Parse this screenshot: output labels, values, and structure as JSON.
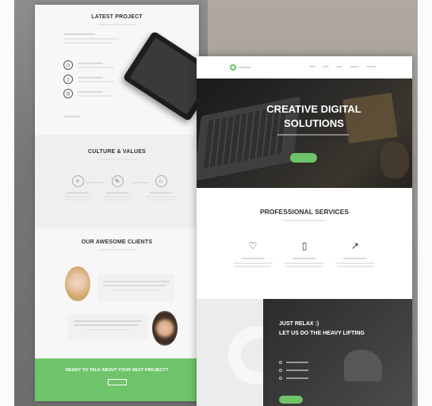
{
  "left_page": {
    "latest_project": {
      "title": "LATEST PROJECT",
      "items": [
        {
          "icon": "clock-icon",
          "glyph": "◷"
        },
        {
          "icon": "phone-icon",
          "glyph": "▯"
        },
        {
          "icon": "lock-icon",
          "glyph": "⊡"
        }
      ]
    },
    "culture": {
      "title": "CULTURE & VALUES",
      "items": [
        {
          "icon": "lightbulb-icon",
          "glyph": "✧"
        },
        {
          "icon": "pen-icon",
          "glyph": "✎"
        },
        {
          "icon": "star-icon",
          "glyph": "☆"
        }
      ]
    },
    "clients": {
      "title": "OUR AWESOME CLIENTS"
    },
    "cta": {
      "text": "READY TO TALK ABOUT YOUR NEXT PROJECT?"
    }
  },
  "right_page": {
    "hero": {
      "title_line1": "CREATIVE DIGITAL",
      "title_line2": "SOLUTIONS"
    },
    "services": {
      "title": "PROFESSIONAL SERVICES",
      "items": [
        {
          "icon": "heart-icon",
          "glyph": "♡"
        },
        {
          "icon": "phone-icon",
          "glyph": "▯"
        },
        {
          "icon": "chart-icon",
          "glyph": "↗"
        }
      ]
    },
    "relax": {
      "title_line1": "JUST RELAX :)",
      "title_line2": "LET US DO THE HEAVY LIFTING"
    }
  },
  "colors": {
    "accent_green": "#6fc36a",
    "dark_hero": "#1a1a1a"
  }
}
